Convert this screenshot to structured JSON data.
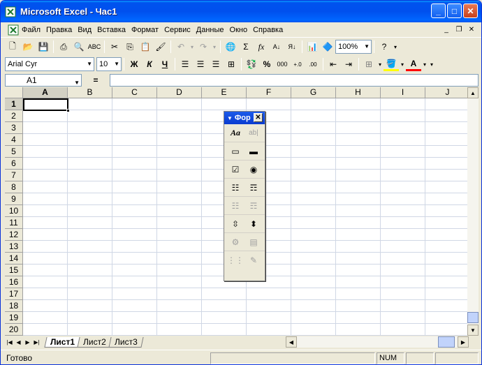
{
  "window": {
    "title": "Microsoft Excel - Час1"
  },
  "menubar": {
    "items": [
      "Файл",
      "Правка",
      "Вид",
      "Вставка",
      "Формат",
      "Сервис",
      "Данные",
      "Окно",
      "Справка"
    ]
  },
  "toolbar_standard": {
    "zoom": "100%"
  },
  "toolbar_formatting": {
    "font": "Arial Cyr",
    "size": "10",
    "bold": "Ж",
    "italic": "К",
    "underline": "Ч",
    "currency": "%",
    "thousands": "000"
  },
  "formula_bar": {
    "name_box": "A1",
    "equals": "=",
    "value": ""
  },
  "grid": {
    "columns": [
      "A",
      "B",
      "C",
      "D",
      "E",
      "F",
      "G",
      "H",
      "I",
      "J"
    ],
    "rows": [
      "1",
      "2",
      "3",
      "4",
      "5",
      "6",
      "7",
      "8",
      "9",
      "10",
      "11",
      "12",
      "13",
      "14",
      "15",
      "16",
      "17",
      "18",
      "19",
      "20"
    ],
    "active_cell": "A1"
  },
  "forms_toolbar": {
    "title": "Фор",
    "label_btn": "Aa",
    "edit_btn": "ab|"
  },
  "sheets": {
    "tabs": [
      "Лист1",
      "Лист2",
      "Лист3"
    ],
    "active": "Лист1"
  },
  "status": {
    "text": "Готово",
    "num": "NUM"
  }
}
